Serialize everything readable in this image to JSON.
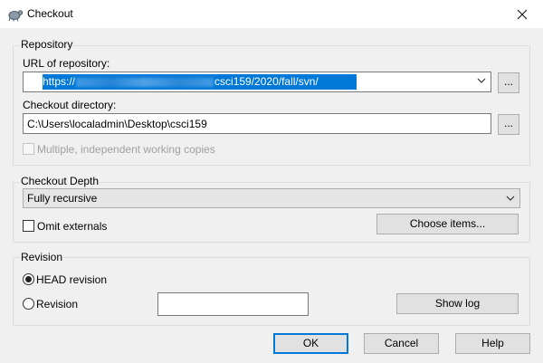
{
  "window": {
    "title": "Checkout"
  },
  "repository": {
    "group_label": "Repository",
    "url_label": "URL of repository:",
    "url_prefix": "https://",
    "url_suffix": "csci159/2020/fall/svn/",
    "checkout_dir_label": "Checkout directory:",
    "checkout_dir_value": "C:\\Users\\localadmin\\Desktop\\csci159",
    "browse_label": "...",
    "multiple_label": "Multiple, independent working copies"
  },
  "depth": {
    "group_label": "Checkout Depth",
    "selected": "Fully recursive",
    "omit_externals_label": "Omit externals",
    "choose_items_label": "Choose items..."
  },
  "revision": {
    "group_label": "Revision",
    "head_label": "HEAD revision",
    "revision_label": "Revision",
    "revision_value": "",
    "show_log_label": "Show log"
  },
  "buttons": {
    "ok": "OK",
    "cancel": "Cancel",
    "help": "Help"
  },
  "colors": {
    "selection": "#0078d7",
    "default_button_border": "#0078d7"
  }
}
